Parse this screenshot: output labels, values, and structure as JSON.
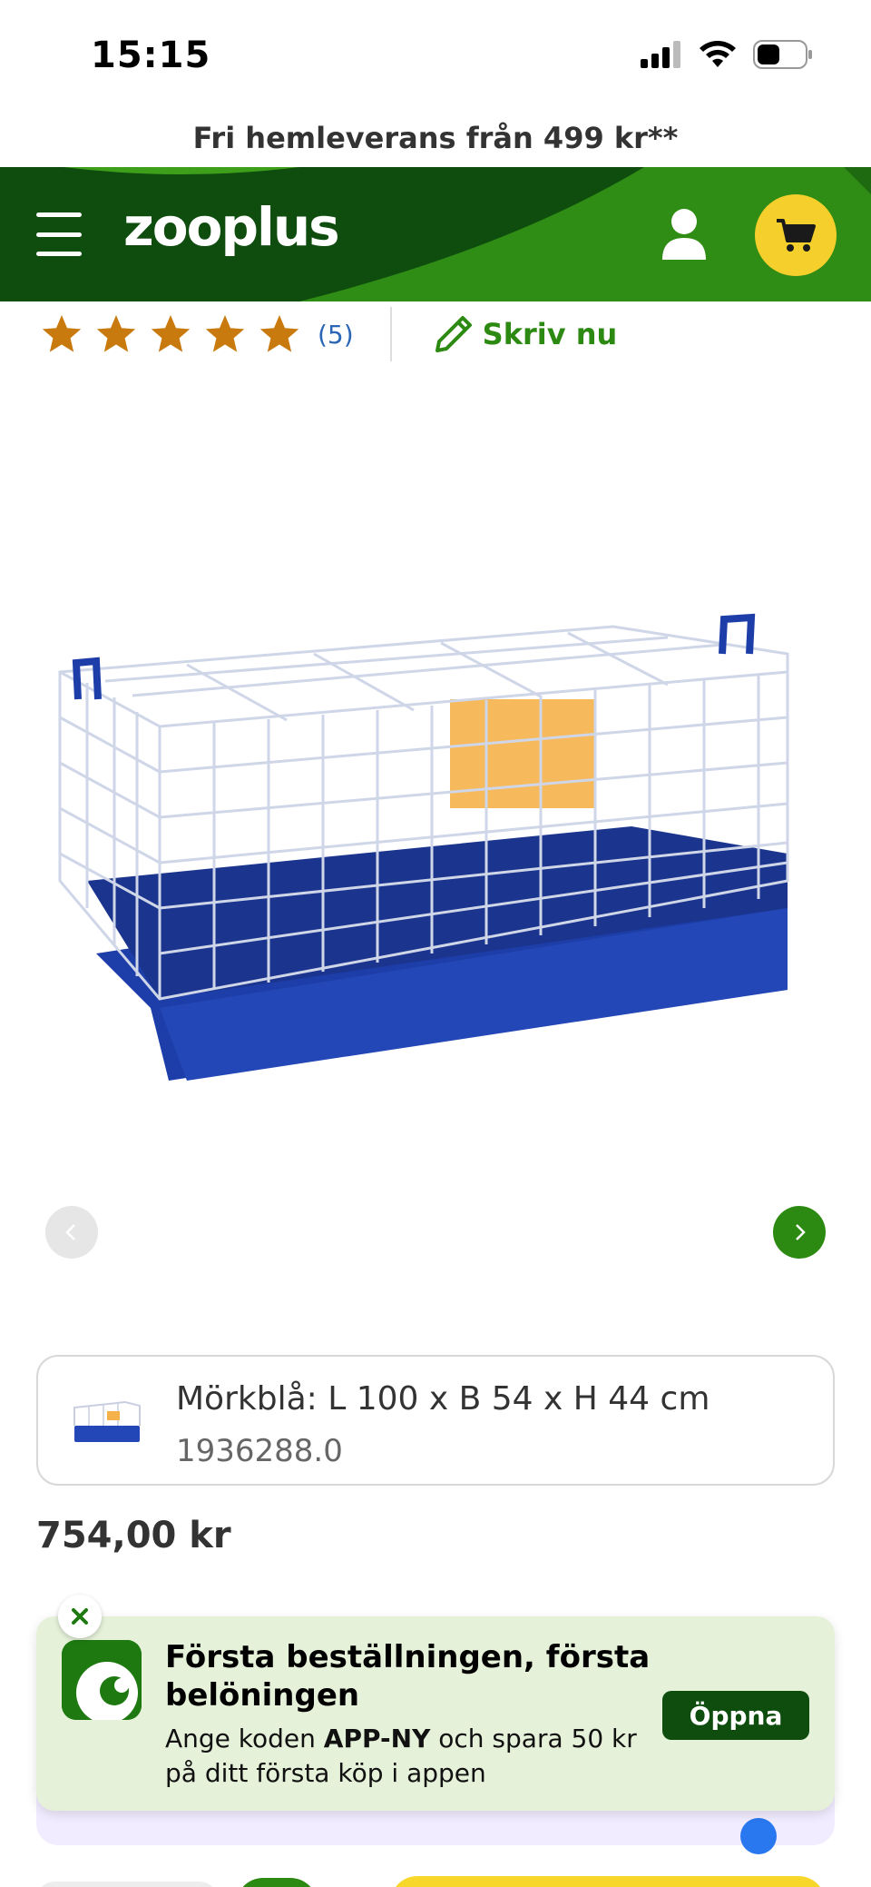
{
  "status_bar": {
    "time": "15:15"
  },
  "delivery_banner": {
    "text": "Fri hemleverans från 499 kr**"
  },
  "header": {
    "logo": "zooplus",
    "colors": {
      "dark_green": "#0f4d0f",
      "green": "#2c8a12",
      "cart_yellow": "#f5cf2c"
    }
  },
  "rating": {
    "stars": 5,
    "review_count": "(5)",
    "write_label": "Skriv nu",
    "star_color": "#c87a0e"
  },
  "product": {
    "variant_name": "Mörkblå: L 100 x B 54 x H 44 cm",
    "variant_code": "1936288.0",
    "price": "754,00 kr"
  },
  "app_banner": {
    "title": "Första beställningen, första belöningen",
    "text_before": "Ange koden ",
    "code": "APP-NY",
    "text_after": " och spara 50 kr på ditt första köp i appen",
    "open_label": "Öppna"
  }
}
